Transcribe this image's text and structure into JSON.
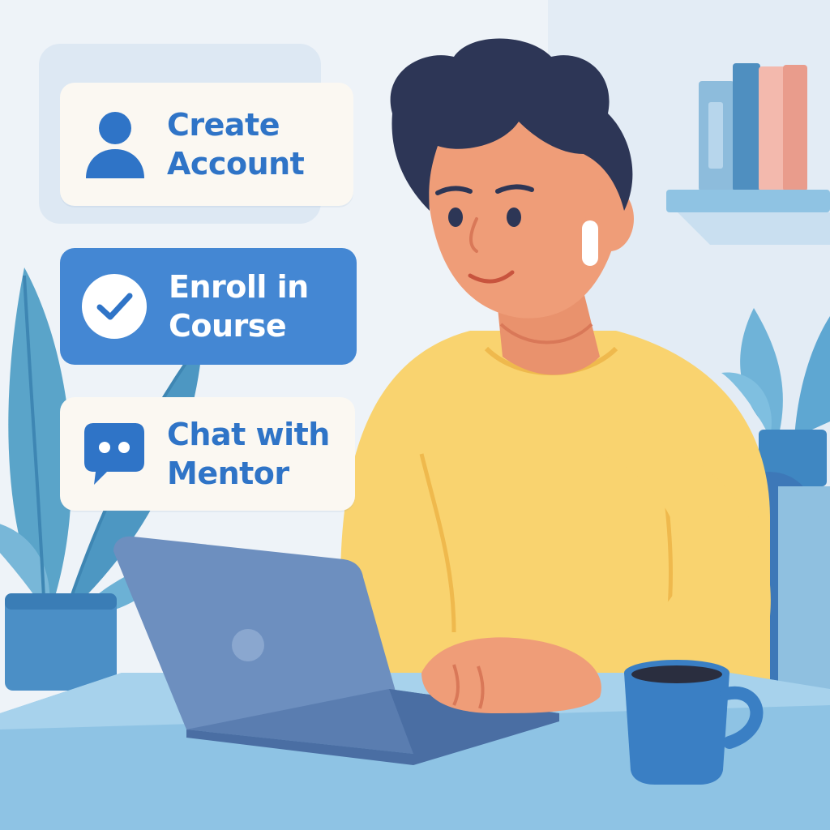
{
  "actions": {
    "create_account": {
      "label_line1": "Create",
      "label_line2": "Account",
      "icon": "user-icon"
    },
    "enroll_course": {
      "label_line1": "Enroll in",
      "label_line2": "Course",
      "icon": "check-circle-icon"
    },
    "chat_mentor": {
      "label_line1": "Chat with",
      "label_line2": "Mentor",
      "icon": "chat-bubble-icon"
    }
  },
  "colors": {
    "accent_blue": "#4487d3",
    "card_text_blue": "#2f74c7",
    "card_background": "#fbf8f2",
    "sweater_yellow": "#f9d36f",
    "laptop_blue": "#6d8fbf",
    "background": "#eef3f8"
  }
}
